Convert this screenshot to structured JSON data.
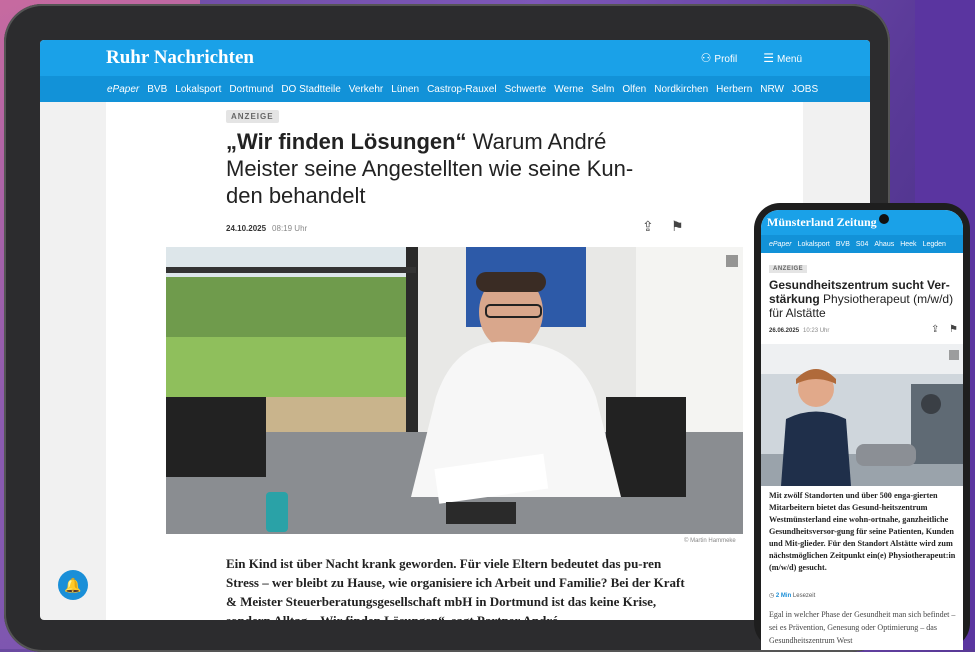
{
  "tablet": {
    "brand": "Ruhr Nachrichten",
    "profile_label": "Profil",
    "menu_label": "Menü",
    "nav": [
      "ePaper",
      "BVB",
      "Lokalsport",
      "Dortmund",
      "DO Stadtteile",
      "Verkehr",
      "Lünen",
      "Castrop-Rauxel",
      "Schwerte",
      "Werne",
      "Selm",
      "Olfen",
      "Nordkirchen",
      "Herbern",
      "NRW",
      "JOBS"
    ],
    "badge": "ANZEIGE",
    "headline_bold": "„Wir finden Lösungen“",
    "headline_rest": " Warum André Meister seine Angestellten wie seine Kun-den behandelt",
    "date": "24.10.2025",
    "time": "08:19 Uhr",
    "photo_credit": "© Martin Hammeke",
    "lead": "Ein Kind ist über Nacht krank geworden. Für viele Eltern bedeutet das pu-ren Stress – wer bleibt zu Hause, wie organisiere ich Arbeit und Familie? Bei der Kraft & Meister Steuerberatungsgesellschaft mbH in Dortmund ist das keine Krise, sondern Alltag. „Wir finden Lösungen“, sagt Partner André"
  },
  "phone": {
    "brand": "Münsterland Zeitung",
    "nav": [
      "ePaper",
      "Lokalsport",
      "BVB",
      "S04",
      "Ahaus",
      "Heek",
      "Legden"
    ],
    "badge": "ANZEIGE",
    "headline_bold": "Gesundheitszentrum sucht Ver-stärkung",
    "headline_rest": " Physiotherapeut (m/w/d) für Alstätte",
    "date": "26.06.2025",
    "time": "10:23 Uhr",
    "lead": "Mit zwölf Standorten und über 500 enga-gierten Mitarbeitern bietet das Gesund-heitszentrum Westmünsterland eine wohn-ortnahe, ganzheitliche Gesundheitsversor-gung für seine Patienten, Kunden und Mit-glieder. Für den Standort Alstätte wird zum nächstmöglichen Zeitpunkt ein(e) Physiotherapeut:in (m/w/d) gesucht.",
    "read_time": "2 Min",
    "read_label": "Lesezeit",
    "body": "Egal in welcher Phase der Gesundheit man sich befindet – sei es Prävention, Genesung oder Optimierung – das Gesundheitszentrum West"
  }
}
